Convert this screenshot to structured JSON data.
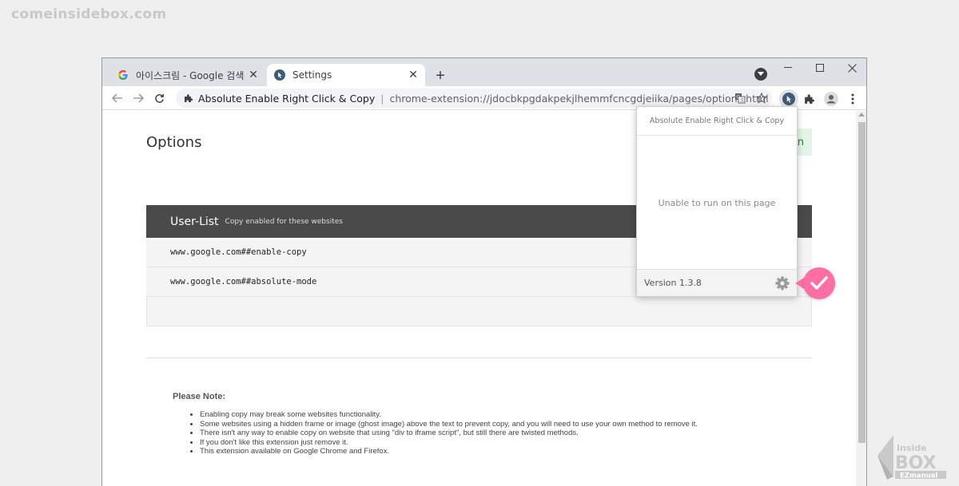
{
  "watermark": {
    "site": "comeinsidebox.com"
  },
  "tabs": [
    {
      "title": "아이스크림 - Google 검색",
      "active": false,
      "icon": "google-g-icon"
    },
    {
      "title": "Settings",
      "active": true,
      "icon": "extension-cursor-icon"
    }
  ],
  "omnibox": {
    "extension_name": "Absolute Enable Right Click & Copy",
    "separator": "|",
    "url": "chrome-extension://jdocbkpgdakpekjlhemmfcncgdjeiika/pages/options.html"
  },
  "page": {
    "title": "Options",
    "header_button_partial": "on"
  },
  "user_list": {
    "title": "User-List",
    "subtitle": "Copy enabled for these websites",
    "rows": [
      "www.google.com##enable-copy",
      "www.google.com##absolute-mode"
    ]
  },
  "note": {
    "title": "Please Note:",
    "items": [
      "Enabling copy may break some websites functionality.",
      "Some websites using a hidden frame or image (ghost image) above the text to prevent copy, and you will need to use your own method to remove it.",
      "There isn't any way to enable copy on website that using \"div to iframe script\", but still there are twisted methods.",
      "If you don't like this extension just remove it.",
      "This extension available on Google Chrome and Firefox."
    ]
  },
  "popup": {
    "title": "Absolute Enable Right Click & Copy",
    "message": "Unable to run on this page",
    "version": "Version 1.3.8"
  },
  "colors": {
    "accent_badge": "#ff6fa5",
    "list_header": "#4a4a4a",
    "tab_strip": "#dee1e6"
  }
}
